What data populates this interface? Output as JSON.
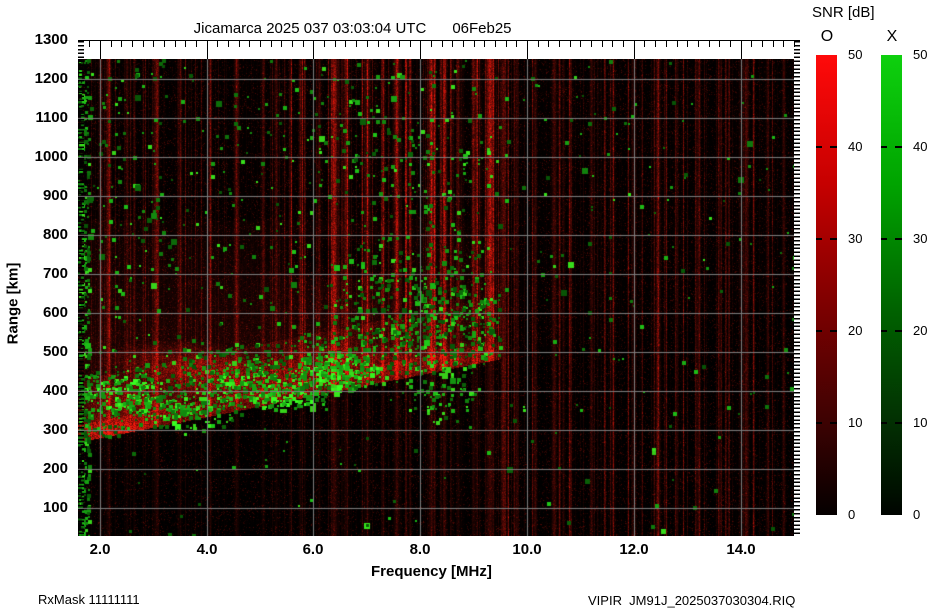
{
  "header": {
    "title_left": "Jicamarca 2025 037 03:03:04 UTC",
    "title_right": "06Feb25"
  },
  "footer": {
    "rx_mask": "RxMask 11111111",
    "file_label": "VIPIR  JM91J_2025037030304.RIQ"
  },
  "chart_data": {
    "type": "heatmap",
    "subtype": "ionogram",
    "title": "Jicamarca 2025 037 03:03:04 UTC  06Feb25",
    "xlabel": "Frequency [MHz]",
    "ylabel": "Range [km]",
    "xlim": [
      1.59,
      15.0
    ],
    "ylim": [
      30,
      1300
    ],
    "xticks": {
      "major_mhz": [
        2.0,
        4.0,
        6.0,
        8.0,
        10.0,
        12.0,
        14.0
      ],
      "labels": [
        "2.0",
        "4.0",
        "6.0",
        "8.0",
        "10.0",
        "12.0",
        "14.0"
      ],
      "minor_step_mhz": 0.2
    },
    "yticks": {
      "major_km": [
        1300,
        1200,
        1100,
        1000,
        900,
        800,
        700,
        600,
        500,
        400,
        300,
        200,
        100
      ],
      "labels": [
        "1300",
        "1200",
        "1100",
        "1000",
        "900",
        "800",
        "700",
        "600",
        "500",
        "400",
        "300",
        "200",
        "100"
      ],
      "minor_step_km": 10
    },
    "grid": {
      "x_mhz": [
        2,
        4,
        6,
        8,
        10,
        12,
        14
      ],
      "y_km": [
        100,
        200,
        300,
        400,
        500,
        600,
        700,
        800,
        900,
        1000,
        1100,
        1200
      ],
      "color": "#7d7d7d",
      "on": true
    },
    "colorbars": {
      "label": "SNR [dB]",
      "range": [
        0,
        50
      ],
      "tick_values": [
        50,
        40,
        30,
        20,
        10,
        0
      ],
      "tick_labels": [
        "50",
        "40",
        "30",
        "20",
        "10",
        "0"
      ],
      "dash_values": [
        40,
        30,
        20,
        10
      ],
      "bars": [
        {
          "mode": "O",
          "polarization": "ordinary",
          "top_color": "#ff0000",
          "bottom_color": "#000000"
        },
        {
          "mode": "X",
          "polarization": "extraordinary",
          "top_color": "#00cc00",
          "bottom_color": "#000000"
        }
      ]
    },
    "phenomena": {
      "seed": 20250206,
      "stripe_band_gain": [
        {
          "f0": 1.59,
          "f1": 5.4,
          "g": 0.5
        },
        {
          "f0": 5.4,
          "f1": 9.9,
          "g": 1.0
        },
        {
          "f0": 9.9,
          "f1": 15.0,
          "g": 0.72
        }
      ],
      "strong_stripes_mhz": [
        [
          2.15,
          1.5,
          0.45
        ],
        [
          2.5,
          1,
          0.28
        ],
        [
          3.05,
          1.5,
          0.42
        ],
        [
          3.5,
          1,
          0.3
        ],
        [
          4.05,
          1,
          0.33
        ],
        [
          4.55,
          1.5,
          0.38
        ],
        [
          5.05,
          1,
          0.33
        ],
        [
          5.3,
          1,
          0.28
        ],
        [
          5.75,
          1,
          0.3
        ],
        [
          6.1,
          1,
          0.33
        ],
        [
          6.38,
          2,
          0.75
        ],
        [
          6.6,
          1.5,
          0.48
        ],
        [
          7.0,
          1.5,
          0.42
        ],
        [
          7.3,
          1,
          0.38
        ],
        [
          7.55,
          2,
          0.55
        ],
        [
          7.8,
          1,
          0.33
        ],
        [
          8.2,
          2,
          0.65
        ],
        [
          8.45,
          1.5,
          0.48
        ],
        [
          8.7,
          1,
          0.38
        ],
        [
          9.0,
          1.5,
          0.42
        ],
        [
          9.3,
          2.5,
          0.8
        ],
        [
          9.55,
          1.5,
          0.45
        ],
        [
          9.8,
          1,
          0.28
        ],
        [
          10.15,
          1,
          0.28
        ],
        [
          10.5,
          1.5,
          0.32
        ],
        [
          10.8,
          1,
          0.22
        ],
        [
          11.2,
          1,
          0.28
        ],
        [
          11.6,
          1,
          0.22
        ],
        [
          12.0,
          1,
          0.22
        ],
        [
          12.45,
          1.5,
          0.28
        ],
        [
          12.8,
          1,
          0.22
        ],
        [
          13.2,
          1,
          0.26
        ],
        [
          13.6,
          1,
          0.22
        ],
        [
          14.1,
          1.5,
          0.28
        ],
        [
          14.5,
          1,
          0.22
        ],
        [
          14.8,
          1,
          0.28
        ]
      ],
      "echo": {
        "f_cutoff_mhz": 9.5,
        "bottom_km_at_2mhz": 280,
        "bottom_slope_km_per_mhz": 27,
        "core_thickness_km": 45,
        "body_thickness_km": 160,
        "spread_top_km": 840,
        "core_intensity": 0.55,
        "body_intensity": 0.3,
        "spread_intensity": 0.15
      },
      "red_patches": [
        [
          2.3,
          300,
          0.9,
          40,
          0.5
        ],
        [
          2.6,
          370,
          1.0,
          60,
          0.3
        ],
        [
          4.6,
          430,
          1.8,
          60,
          0.38
        ],
        [
          6.3,
          470,
          1.2,
          55,
          0.33
        ],
        [
          3.4,
          480,
          1.5,
          50,
          0.28
        ],
        [
          7.8,
          480,
          1.0,
          45,
          0.25
        ],
        [
          8.8,
          490,
          0.7,
          40,
          0.28
        ]
      ],
      "dark_hole": [
        6.5,
        745,
        1.8,
        68
      ],
      "green": {
        "base_density": 0.03,
        "right_density": 0.012,
        "below_boundary_density": 0.006,
        "left_column_fmax": 1.8,
        "left_column_density": 0.45,
        "echo_band_density": 0.2,
        "clusters": [
          [
            2.4,
            400,
            0.9,
            70,
            0.45,
            0.3
          ],
          [
            3.6,
            350,
            1.1,
            60,
            0.4,
            0.2
          ],
          [
            4.8,
            420,
            1.3,
            70,
            0.4,
            0.2
          ],
          [
            6.4,
            460,
            0.9,
            60,
            0.55,
            0.4
          ],
          [
            5.6,
            380,
            0.8,
            40,
            0.35,
            0.3
          ],
          [
            7.3,
            650,
            1.2,
            180,
            0.16,
            0
          ],
          [
            8.6,
            640,
            1.0,
            200,
            0.18,
            0
          ],
          [
            8.3,
            400,
            1.0,
            80,
            0.25,
            0.1
          ],
          [
            7.0,
            1050,
            1.5,
            200,
            0.05,
            0
          ],
          [
            8.5,
            950,
            1.2,
            150,
            0.06,
            0
          ],
          [
            2.5,
            900,
            0.8,
            350,
            0.04,
            0
          ]
        ]
      }
    }
  }
}
